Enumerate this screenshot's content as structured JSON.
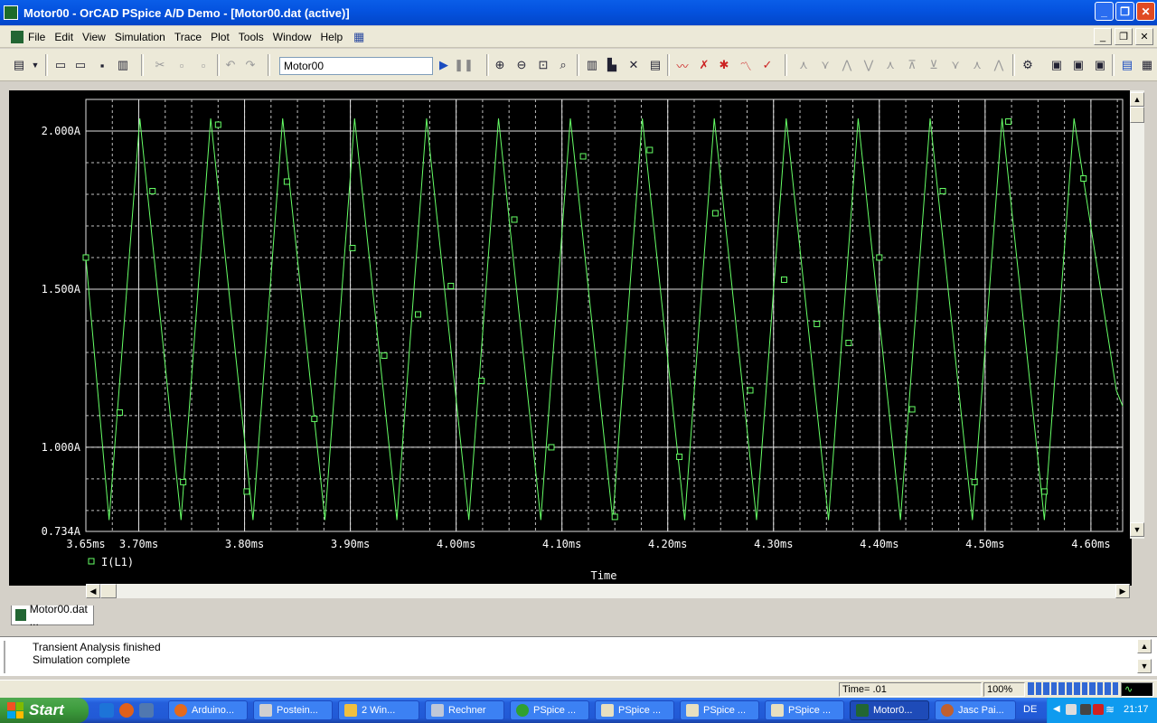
{
  "window": {
    "title": "Motor00 - OrCAD PSpice A/D Demo  - [Motor00.dat (active)]",
    "buttons": [
      "_",
      "❐",
      "✕"
    ]
  },
  "menu": [
    "File",
    "Edit",
    "View",
    "Simulation",
    "Trace",
    "Plot",
    "Tools",
    "Window",
    "Help"
  ],
  "toolbar": {
    "profile": "Motor00"
  },
  "chart_data": {
    "type": "line",
    "title": "",
    "xlabel": "Time",
    "ylabel": "",
    "background": "#000000",
    "trace_color": "#66ff66",
    "grid_color": "#e0e0e0",
    "xlim": [
      3.65,
      4.63
    ],
    "ylim": [
      0.734,
      2.1
    ],
    "x_ticks": [
      "3.65ms",
      "3.70ms",
      "3.80ms",
      "3.90ms",
      "4.00ms",
      "4.10ms",
      "4.20ms",
      "4.30ms",
      "4.40ms",
      "4.50ms",
      "4.60ms"
    ],
    "x_tick_values": [
      3.65,
      3.7,
      3.8,
      3.9,
      4.0,
      4.1,
      4.2,
      4.3,
      4.4,
      4.5,
      4.6
    ],
    "y_ticks": [
      "2.000A",
      "1.500A",
      "1.000A",
      "0.734A"
    ],
    "y_tick_values": [
      2.0,
      1.5,
      1.0,
      0.734
    ],
    "series": [
      {
        "name": "I(L1)",
        "x": [
          3.65,
          3.672,
          3.701,
          3.74,
          3.768,
          3.808,
          3.836,
          3.876,
          3.904,
          3.944,
          3.972,
          4.012,
          4.04,
          4.08,
          4.108,
          4.148,
          4.176,
          4.216,
          4.244,
          4.284,
          4.312,
          4.352,
          4.38,
          4.42,
          4.448,
          4.488,
          4.516,
          4.556,
          4.584,
          4.624,
          4.63
        ],
        "values": [
          1.6,
          0.77,
          2.04,
          0.77,
          2.04,
          0.77,
          2.04,
          0.77,
          2.04,
          0.77,
          2.04,
          0.77,
          2.04,
          0.77,
          2.04,
          0.77,
          2.04,
          0.77,
          2.04,
          0.77,
          2.04,
          0.77,
          2.04,
          0.77,
          2.04,
          0.77,
          2.04,
          0.77,
          2.04,
          1.18,
          1.13
        ],
        "markers_x": [
          3.65,
          3.682,
          3.713,
          3.742,
          3.775,
          3.802,
          3.84,
          3.866,
          3.902,
          3.932,
          3.964,
          3.995,
          4.024,
          4.055,
          4.09,
          4.12,
          4.15,
          4.183,
          4.211,
          4.245,
          4.278,
          4.31,
          4.341,
          4.371,
          4.4,
          4.431,
          4.46,
          4.49,
          4.522,
          4.556,
          4.593
        ],
        "markers_y": [
          1.6,
          1.11,
          1.81,
          0.89,
          2.02,
          0.86,
          1.84,
          1.09,
          1.63,
          1.29,
          1.42,
          1.51,
          1.21,
          1.72,
          1.0,
          1.92,
          0.78,
          1.94,
          0.97,
          1.74,
          1.18,
          1.53,
          1.39,
          1.33,
          1.6,
          1.12,
          1.81,
          0.89,
          2.03,
          0.86,
          1.85
        ]
      }
    ],
    "grid": true,
    "legend": "bottom-left"
  },
  "tab": {
    "label": "Motor00.dat ..."
  },
  "output": [
    "Transient Analysis finished",
    "Simulation complete"
  ],
  "status": {
    "time": "Time= .01",
    "zoom": "100%"
  },
  "taskbar": {
    "start": "Start",
    "tasks": [
      "Arduino...",
      "Postein...",
      "2 Win...",
      "Rechner",
      "PSpice ...",
      "PSpice ...",
      "PSpice ...",
      "PSpice ...",
      "Motor0...",
      "Jasc Pai..."
    ],
    "language": "DE",
    "clock": "21:17"
  }
}
